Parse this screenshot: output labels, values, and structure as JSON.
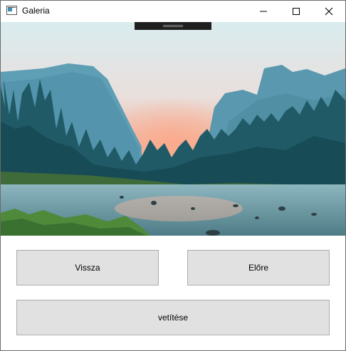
{
  "window": {
    "title": "Galeria"
  },
  "controls": {
    "minimize_icon": "minimize-icon",
    "maximize_icon": "maximize-icon",
    "close_icon": "close-icon"
  },
  "buttons": {
    "back": "Vissza",
    "forward": "Előre",
    "slideshow": "vetítése"
  },
  "image": {
    "subject": "mountain valley river landscape"
  },
  "colors": {
    "button_bg": "#e1e1e1",
    "button_border": "#adadad",
    "handle": "#1f1f1f"
  }
}
